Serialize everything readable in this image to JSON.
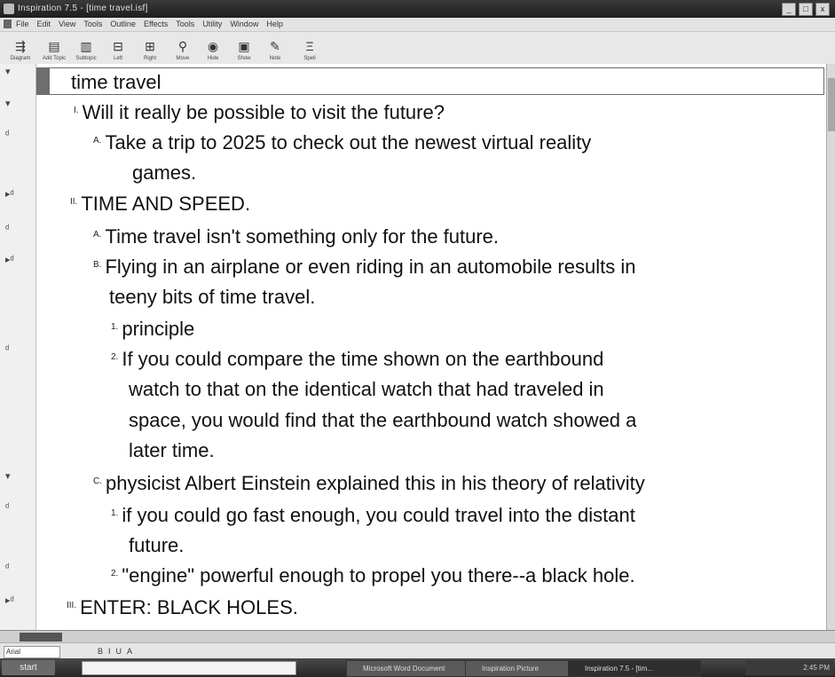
{
  "window": {
    "title": "Inspiration 7.5 - [time travel.isf]",
    "controls": [
      "_",
      "□",
      "x"
    ]
  },
  "menu": [
    "File",
    "Edit",
    "View",
    "Tools",
    "Outline",
    "Effects",
    "Tools",
    "Utility",
    "Window",
    "Help"
  ],
  "toolbar": {
    "items": [
      {
        "icon": "diagram-icon",
        "label": "Diagram",
        "glyph": "⇶"
      },
      {
        "icon": "add-topic-icon",
        "label": "Add Topic",
        "glyph": "▤"
      },
      {
        "icon": "subtopic-icon",
        "label": "Subtopic",
        "glyph": "▥"
      },
      {
        "icon": "left-icon",
        "label": "Left",
        "glyph": "⊟"
      },
      {
        "icon": "right-icon",
        "label": "Right",
        "glyph": "⊞"
      },
      {
        "icon": "move-icon",
        "label": "Move",
        "glyph": "⚲"
      },
      {
        "icon": "hide-icon",
        "label": "Hide",
        "glyph": "◉"
      },
      {
        "icon": "show-icon",
        "label": "Show",
        "glyph": "▣"
      },
      {
        "icon": "note-icon",
        "label": "Note",
        "glyph": "✎"
      },
      {
        "icon": "spell-icon",
        "label": "Spell",
        "glyph": "Ξ"
      }
    ]
  },
  "outline": {
    "main_topic": "time travel",
    "items": [
      {
        "prefix": "I.",
        "text": "Will it really be possible to visit the future?",
        "cont": ""
      },
      {
        "prefix": "A.",
        "text": "Take a trip to 2025 to check out the newest virtual reality",
        "cont": "games."
      },
      {
        "prefix": "II.",
        "text": "TIME AND SPEED.",
        "cont": ""
      },
      {
        "prefix": "A.",
        "text": "Time travel isn't something only for the future.",
        "cont": ""
      },
      {
        "prefix": "B.",
        "text": "Flying in an airplane or even riding in an automobile results in",
        "cont": "teeny bits of time travel."
      },
      {
        "prefix": "1.",
        "text": "principle",
        "cont": ""
      },
      {
        "prefix": "2.",
        "text": "If you could compare the time shown on the earthbound",
        "cont1": "watch to that on the identical watch that had traveled in",
        "cont2": "space, you would find that the earthbound watch showed a",
        "cont3": "later time."
      },
      {
        "prefix": "C.",
        "text": "physicist Albert Einstein explained this in his theory  of relativity",
        "cont": ""
      },
      {
        "prefix": "1.",
        "text": "if you could go fast enough, you could travel into the distant",
        "cont": "future."
      },
      {
        "prefix": "2.",
        "text": "\"engine\" powerful enough to propel you there--a black hole.",
        "cont": ""
      },
      {
        "prefix": "III.",
        "text": "ENTER: BLACK HOLES.",
        "cont": ""
      }
    ]
  },
  "formatbar": {
    "font": "Arial",
    "items": [
      "B",
      "I",
      "U",
      "A"
    ]
  },
  "taskbar": {
    "start": "start",
    "tasks": [
      {
        "label": "Microsoft Word Document"
      },
      {
        "label": "Inspiration Picture"
      },
      {
        "label": "Inspiration 7.5 - [tim..."
      }
    ],
    "clock": "2:45 PM"
  }
}
